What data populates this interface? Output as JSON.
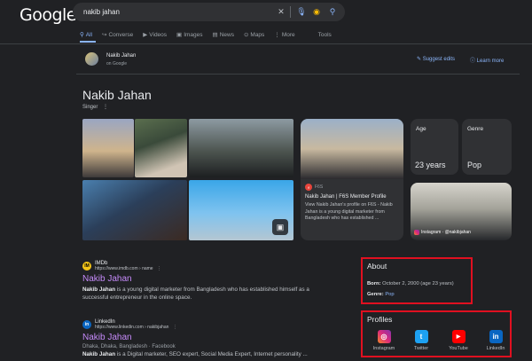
{
  "header": {
    "logo": "Google",
    "search_value": "nakib jahan"
  },
  "tabs": [
    "All",
    "Converse",
    "Videos",
    "Images",
    "News",
    "Maps",
    "More",
    "Tools"
  ],
  "entity_bar": {
    "name": "Nakib Jahan",
    "source": "on Google",
    "suggest": "Suggest edits",
    "learn": "Learn more"
  },
  "entity": {
    "title": "Nakib Jahan",
    "subtitle": "Singer"
  },
  "f6s_card": {
    "source": "F6S",
    "title": "Nakib Jahan | F6S Member Profile",
    "snippet": "View Nakib Jahan's profile on F6S - Nakib Jahan is a young digital marketer from Bangladesh who has established ..."
  },
  "facts": {
    "age_label": "Age",
    "age_value": "23 years",
    "genre_label": "Genre",
    "genre_value": "Pop"
  },
  "instagram_thumb": "Instagram · @nakibjahan",
  "results": [
    {
      "site": "IMDb",
      "url": "https://www.imdb.com › name",
      "title": "Nakib Jahan",
      "snippet_bold": "Nakib Jahan",
      "snippet": " is a young digital marketer from Bangladesh who has established himself as a successful entrepreneur in the online space."
    },
    {
      "site": "LinkedIn",
      "url": "https://www.linkedin.com › nakibjahan",
      "title": "Nakib Jahan",
      "meta": "Dhaka, Dhaka, Bangladesh · Facebook",
      "snippet_bold": "Nakib Jahan",
      "snippet": " is a Digital marketer, SEO expert, Social Media Expert, Internet personality ..."
    }
  ],
  "about": {
    "title": "About",
    "born_label": "Born:",
    "born_value": "October 2, 2000 (age 23 years)",
    "genre_label": "Genre:",
    "genre_value": "Pop"
  },
  "profiles": {
    "title": "Profiles",
    "items": [
      "Instagram",
      "Twitter",
      "YouTube",
      "LinkedIn"
    ]
  },
  "colors": {
    "background": "#202124",
    "link": "#8ab4f8",
    "visited": "#c58af9",
    "highlight_box": "#e01020"
  }
}
